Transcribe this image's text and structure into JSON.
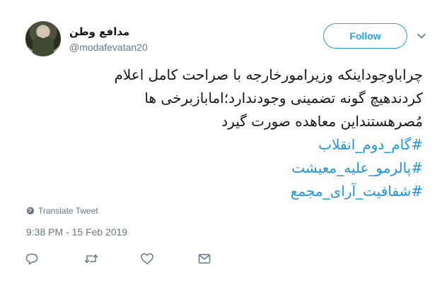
{
  "user": {
    "display_name": "مدافع وطن",
    "handle": "@modafevatan20"
  },
  "follow_button": {
    "label": "Follow"
  },
  "tweet": {
    "lines": [
      "چراباوجوداینکه وزیرامورخارجه با صراحت کامل اعلام",
      "کردندهیچ گونه تضمینی وجودندارد؛امابازبرخی ها",
      "مُصرهستنداین معاهده صورت گیرد"
    ],
    "hashtags": [
      "#گام_دوم_انقلاب",
      "#پالرمو_علیه_معیشت",
      "#شفافیت_آرای_مجمع"
    ]
  },
  "translate_label": "Translate Tweet",
  "timestamp": "9:38 PM - 15 Feb 2019",
  "colors": {
    "accent": "#1da1f2",
    "hashtag": "#1b95e0",
    "muted": "#657786"
  },
  "icons": {
    "caret": "chevron-down-icon",
    "translate": "globe-icon",
    "reply": "reply-icon",
    "retweet": "retweet-icon",
    "like": "heart-icon",
    "message": "envelope-icon"
  }
}
